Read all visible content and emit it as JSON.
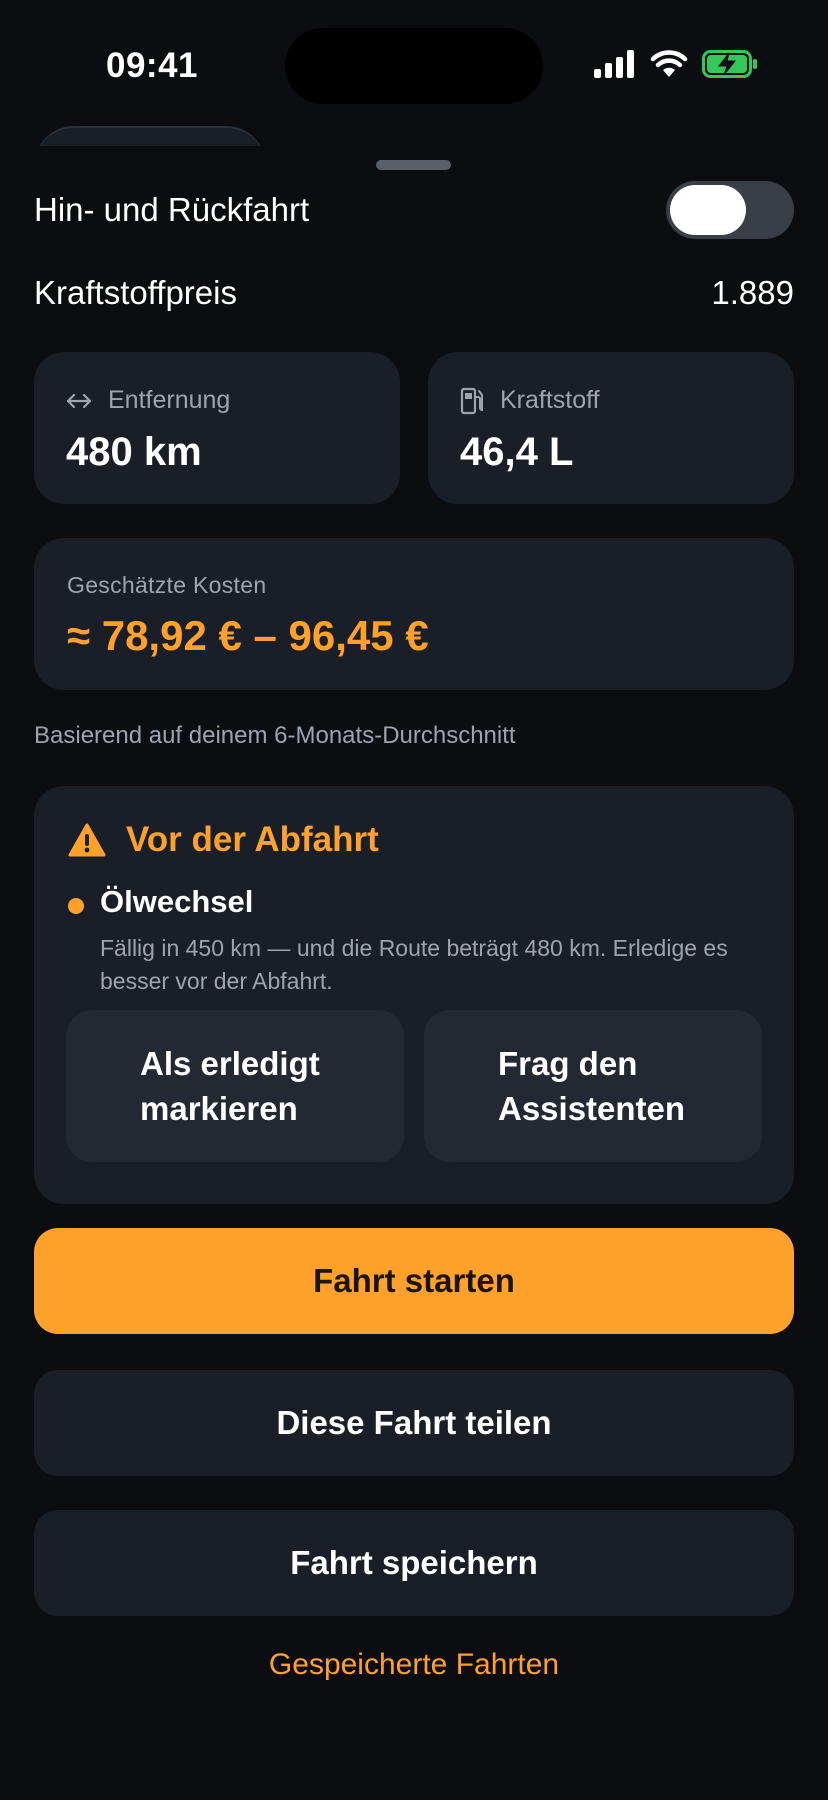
{
  "status": {
    "time": "09:41"
  },
  "trip": {
    "round_trip_label": "Hin- und Rückfahrt",
    "round_trip_on": false,
    "fuel_price_label": "Kraftstoffpreis",
    "fuel_price_value": "1.889"
  },
  "stats": {
    "distance": {
      "label": "Entfernung",
      "value": "480 km",
      "icon": "arrows-horizontal-icon"
    },
    "fuel": {
      "label": "Kraftstoff",
      "value": "46,4 L",
      "icon": "fuel-pump-icon"
    }
  },
  "cost": {
    "label": "Geschätzte Kosten",
    "value": "≈ 78,92 € – 96,45 €",
    "note": "Basierend auf deinem 6-Monats-Durchschnitt"
  },
  "warning": {
    "title": "Vor der Abfahrt",
    "icon": "warning-triangle-icon",
    "item_title": "Ölwechsel",
    "item_desc": "Fällig in 450 km — und die Route beträgt 480 km. Erledige es besser vor der Abfahrt.",
    "mark_done_label": "Als erledigt\nmarkieren",
    "ask_assistant_label": "Frag den\nAssistenten"
  },
  "actions": {
    "start_label": "Fahrt starten",
    "share_label": "Diese Fahrt teilen",
    "save_label": "Fahrt speichern",
    "saved_link": "Gespeicherte Fahrten"
  },
  "colors": {
    "accent": "#ffa12b",
    "card": "#1a1f27",
    "background": "#0b0d11",
    "battery": "#34c759"
  }
}
